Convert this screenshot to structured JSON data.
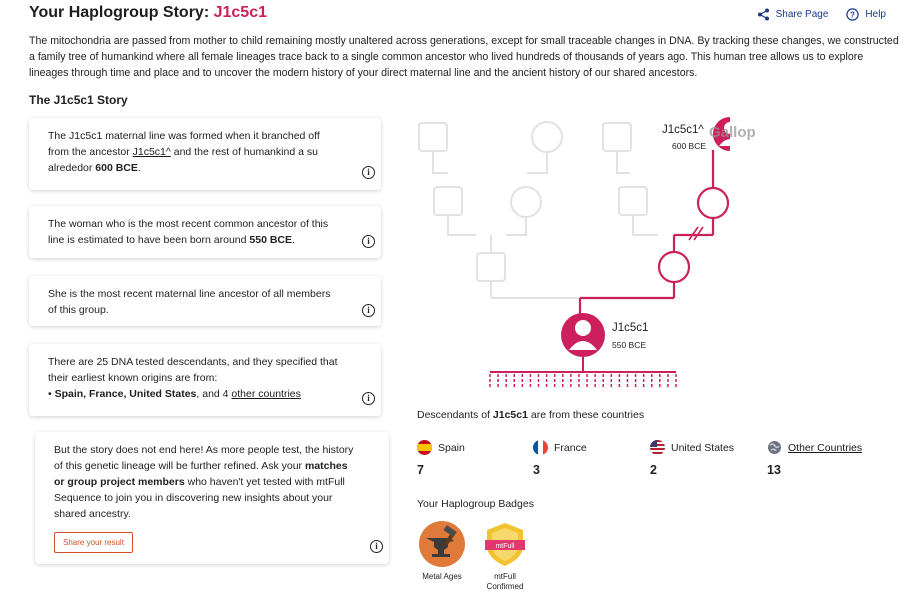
{
  "header": {
    "title_prefix": "Your Haplogroup Story: ",
    "haplogroup": "J1c5c1",
    "share_label": "Share Page",
    "help_label": "Help"
  },
  "intro": "The mitochondria are passed from mother to child remaining mostly unaltered across generations, except for small traceable changes in DNA. By tracking these changes, we constructed a family tree of humankind where all female lineages trace back to a single common ancestor who lived hundreds of thousands of years ago. This human tree allows us to explore lineages through time and place and to uncover the modern history of your direct maternal line and the ancient history of our shared ancestors.",
  "story_heading": "The J1c5c1 Story",
  "cards": {
    "c1_a": "The J1c5c1 maternal line was formed when it branched off from the ancestor ",
    "c1_link": "J1c5c1^",
    "c1_b": " and the rest of humankind a su alrededor ",
    "c1_date": "600 BCE",
    "c1_end": ".",
    "c2_a": "The woman who is the most recent common ancestor of this line is estimated to have been born around ",
    "c2_date": "550 BCE",
    "c2_end": ".",
    "c3": "She is the most recent maternal line ancestor of all members of this group.",
    "c4_a": "There are 25 DNA tested descendants, and they specified that their earliest known origins are from:",
    "c4_countries": "Spain, France, United States",
    "c4_mid": ", and 4 ",
    "c4_link": "other countries",
    "c5_a": "But the story does not end here! As more people test, the history of this genetic lineage will be further refined. Ask your ",
    "c5_bold": "matches or group project members",
    "c5_b": " who haven't yet tested with mtFull Sequence to join you in discovering new insights about your shared ancestry.",
    "share_result": "Share your result"
  },
  "tree": {
    "ancestor_name": "J1c5c1^",
    "ancestor_date": "600 BCE",
    "node_name": "J1c5c1",
    "node_date": "550 BCE",
    "watermark": "Gallop"
  },
  "descendants": {
    "title_a": "Descendants of ",
    "title_hg": "J1c5c1",
    "title_b": " are from these countries",
    "countries": [
      {
        "name": "Spain",
        "count": "7"
      },
      {
        "name": "France",
        "count": "3"
      },
      {
        "name": "United States",
        "count": "2"
      },
      {
        "name": "Other Countries",
        "count": "13"
      }
    ]
  },
  "badges": {
    "title": "Your Haplogroup Badges",
    "items": [
      {
        "label": "Metal Ages"
      },
      {
        "label": "mtFull Confirmed",
        "tag": "mtFull"
      }
    ]
  },
  "colors": {
    "accent": "#cc1f5b",
    "gray_lines": "#e2e2e2",
    "link_blue": "#1a3a8c",
    "button_orange": "#d4502a"
  }
}
